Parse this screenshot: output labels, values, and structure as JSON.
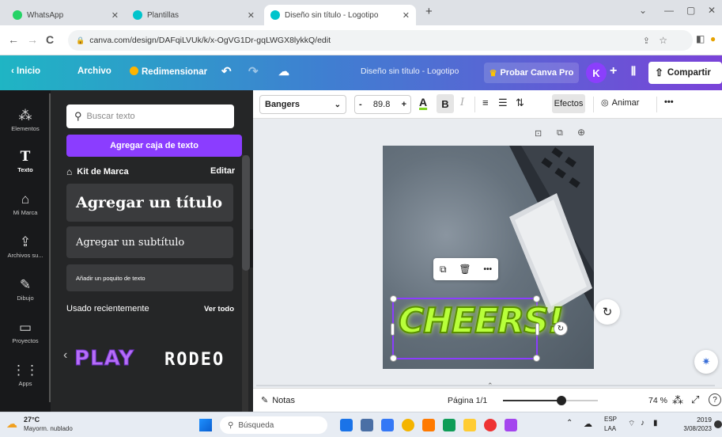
{
  "browser": {
    "tabs": [
      {
        "title": "WhatsApp",
        "color": "#25d366"
      },
      {
        "title": "Plantillas",
        "color": "#00c4cc"
      },
      {
        "title": "Diseño sin título - Logotipo",
        "color": "#00c4cc"
      }
    ],
    "new_tab": "+",
    "url": "canva.com/design/DAFqiLVUk/k/x-OgVG1Dr-gqLWGX8lykkQ/edit"
  },
  "canva_header": {
    "back": "Inicio",
    "file": "Archivo",
    "resize": "Redimensionar",
    "doc_title": "Diseño sin título - Logotipo",
    "try_pro": "Probar Canva Pro",
    "avatar": "K",
    "share": "Compartir"
  },
  "rail": {
    "items": [
      {
        "label": "Elementos",
        "icon": "elements-icon"
      },
      {
        "label": "Texto",
        "icon": "text-icon"
      },
      {
        "label": "Mi Marca",
        "icon": "brand-icon"
      },
      {
        "label": "Archivos su...",
        "icon": "upload-icon"
      },
      {
        "label": "Dibujo",
        "icon": "draw-icon"
      },
      {
        "label": "Proyectos",
        "icon": "folder-icon"
      },
      {
        "label": "Apps",
        "icon": "apps-icon"
      }
    ]
  },
  "panel": {
    "search_placeholder": "Buscar texto",
    "add_textbox": "Agregar caja de texto",
    "brand_kit": "Kit de Marca",
    "edit": "Editar",
    "add_title": "Agregar un título",
    "add_subtitle": "Agregar un subtítulo",
    "add_body": "Añadir un poquito de texto",
    "recent": "Usado recientemente",
    "see_all": "Ver todo",
    "recent_fonts": [
      "PLAY",
      "RODEO"
    ]
  },
  "toolbar": {
    "font": "Bangers",
    "size": "89.8",
    "minus": "-",
    "plus": "+",
    "color_letter": "A",
    "bold": "B",
    "italic": "I",
    "effects": "Efectos",
    "animate": "Animar",
    "more": "•••"
  },
  "canvas": {
    "text": "CHEERS!",
    "text_color": "#b8ff3a",
    "float_more": "•••"
  },
  "bottom": {
    "notes": "Notas",
    "page": "Página 1/1",
    "zoom": "74 %",
    "zoom_fraction": 0.62
  },
  "taskbar": {
    "temp": "27°C",
    "weather": "Mayorm. nublado",
    "search": "Búsqueda",
    "lang1": "ESP",
    "lang2": "LAA",
    "time": "2019",
    "date": "3/08/2023"
  }
}
